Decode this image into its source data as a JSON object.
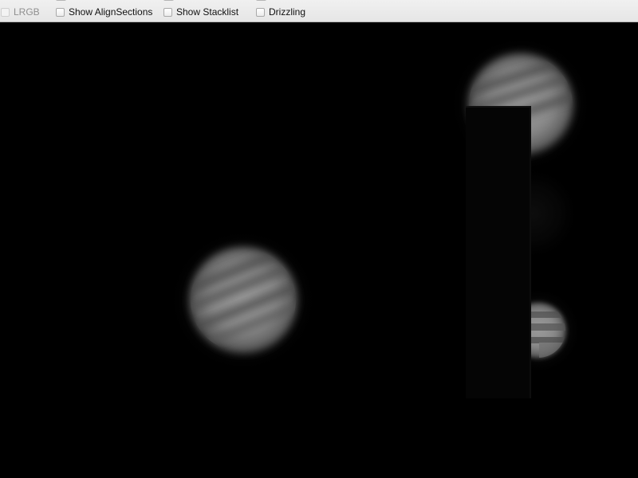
{
  "toolbar": {
    "options": [
      {
        "label": "LRGB",
        "checked": false,
        "enabled": false
      },
      {
        "label": "Show AlignSections",
        "checked": false,
        "enabled": true
      },
      {
        "label": "Show Stacklist",
        "checked": false,
        "enabled": true
      },
      {
        "label": "Drizzling",
        "checked": false,
        "enabled": true
      }
    ]
  },
  "viewer": {
    "content": "jupiter-frames"
  },
  "colors": {
    "toolbar_bg": "#ececec",
    "viewer_bg": "#000000",
    "planet_light": "#c8c8c8",
    "planet_band": "#5a5a5a"
  }
}
